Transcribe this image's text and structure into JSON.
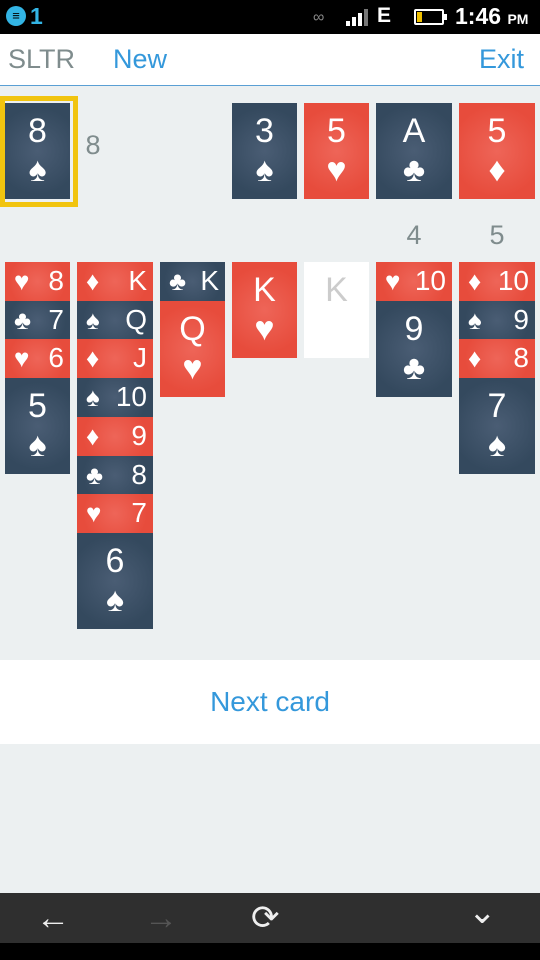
{
  "status_bar": {
    "notification_icon": "menu-notification-icon",
    "notification_count": "1",
    "network": "E",
    "time": "1:46",
    "ampm": "PM",
    "battery_level": 0.15
  },
  "header": {
    "title": "SLTR",
    "new_label": "New",
    "exit_label": "Exit"
  },
  "stock": {
    "card": {
      "rank": "8",
      "suit": "♠",
      "color": "dark"
    },
    "count": "8",
    "selected": true,
    "highlight_color": "#f1c40f"
  },
  "foundations": [
    {
      "rank": "3",
      "suit": "♠",
      "color": "dark"
    },
    {
      "rank": "5",
      "suit": "♥",
      "color": "red"
    },
    {
      "rank": "A",
      "suit": "♣",
      "color": "dark"
    },
    {
      "rank": "5",
      "suit": "♦",
      "color": "red"
    }
  ],
  "column_counts": [
    null,
    null,
    null,
    null,
    null,
    "4",
    "5"
  ],
  "tableau": [
    {
      "cards": [
        {
          "rank": "8",
          "suit": "♥",
          "color": "red"
        },
        {
          "rank": "7",
          "suit": "♣",
          "color": "dark"
        },
        {
          "rank": "6",
          "suit": "♥",
          "color": "red"
        },
        {
          "rank": "5",
          "suit": "♠",
          "color": "dark"
        }
      ]
    },
    {
      "cards": [
        {
          "rank": "K",
          "suit": "♦",
          "color": "red"
        },
        {
          "rank": "Q",
          "suit": "♠",
          "color": "dark"
        },
        {
          "rank": "J",
          "suit": "♦",
          "color": "red"
        },
        {
          "rank": "10",
          "suit": "♠",
          "color": "dark"
        },
        {
          "rank": "9",
          "suit": "♦",
          "color": "red"
        },
        {
          "rank": "8",
          "suit": "♣",
          "color": "dark"
        },
        {
          "rank": "7",
          "suit": "♥",
          "color": "red"
        },
        {
          "rank": "6",
          "suit": "♠",
          "color": "dark"
        }
      ]
    },
    {
      "cards": [
        {
          "rank": "K",
          "suit": "♣",
          "color": "dark"
        },
        {
          "rank": "Q",
          "suit": "♥",
          "color": "red"
        }
      ]
    },
    {
      "cards": [
        {
          "rank": "K",
          "suit": "♥",
          "color": "red"
        }
      ]
    },
    {
      "cards": [],
      "empty_label": "K"
    },
    {
      "cards": [
        {
          "rank": "10",
          "suit": "♥",
          "color": "red"
        },
        {
          "rank": "9",
          "suit": "♣",
          "color": "dark"
        }
      ]
    },
    {
      "cards": [
        {
          "rank": "10",
          "suit": "♦",
          "color": "red"
        },
        {
          "rank": "9",
          "suit": "♠",
          "color": "dark"
        },
        {
          "rank": "8",
          "suit": "♦",
          "color": "red"
        },
        {
          "rank": "7",
          "suit": "♠",
          "color": "dark"
        }
      ]
    }
  ],
  "next_card_label": "Next card",
  "nav": {
    "back": "←",
    "forward": "→",
    "reload": "⟳",
    "menu": "⌄"
  },
  "colors": {
    "dark_card": "#34495e",
    "red_card": "#e74c3c",
    "accent": "#3498db",
    "background": "#ecf0f1"
  }
}
